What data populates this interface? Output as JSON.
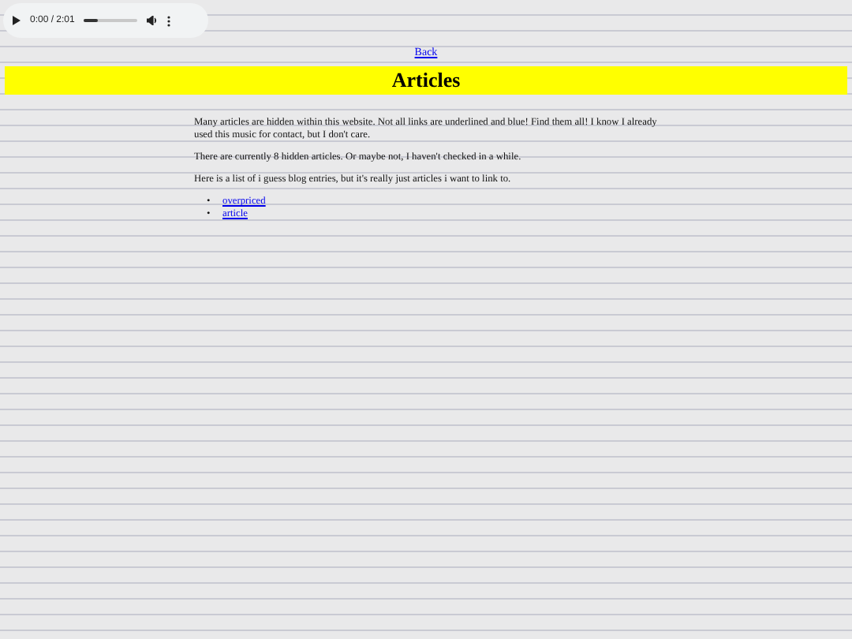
{
  "audio_player": {
    "time": "0:00 / 2:01",
    "level": 0.25
  },
  "back_link": "Back",
  "title": "Articles",
  "paragraphs": [
    "Many articles are hidden within this website. Not all links are underlined and blue! Find them all! I know I already used this music for contact, but I don't care.",
    "There are currently 8 hidden articles. Or maybe not, I haven't checked in a while.",
    "Here is a list of i guess blog entries, but it's really just articles i want to link to."
  ],
  "links": [
    {
      "bullet": "•",
      "label": "overpriced"
    },
    {
      "bullet": "•",
      "label": "article"
    }
  ]
}
